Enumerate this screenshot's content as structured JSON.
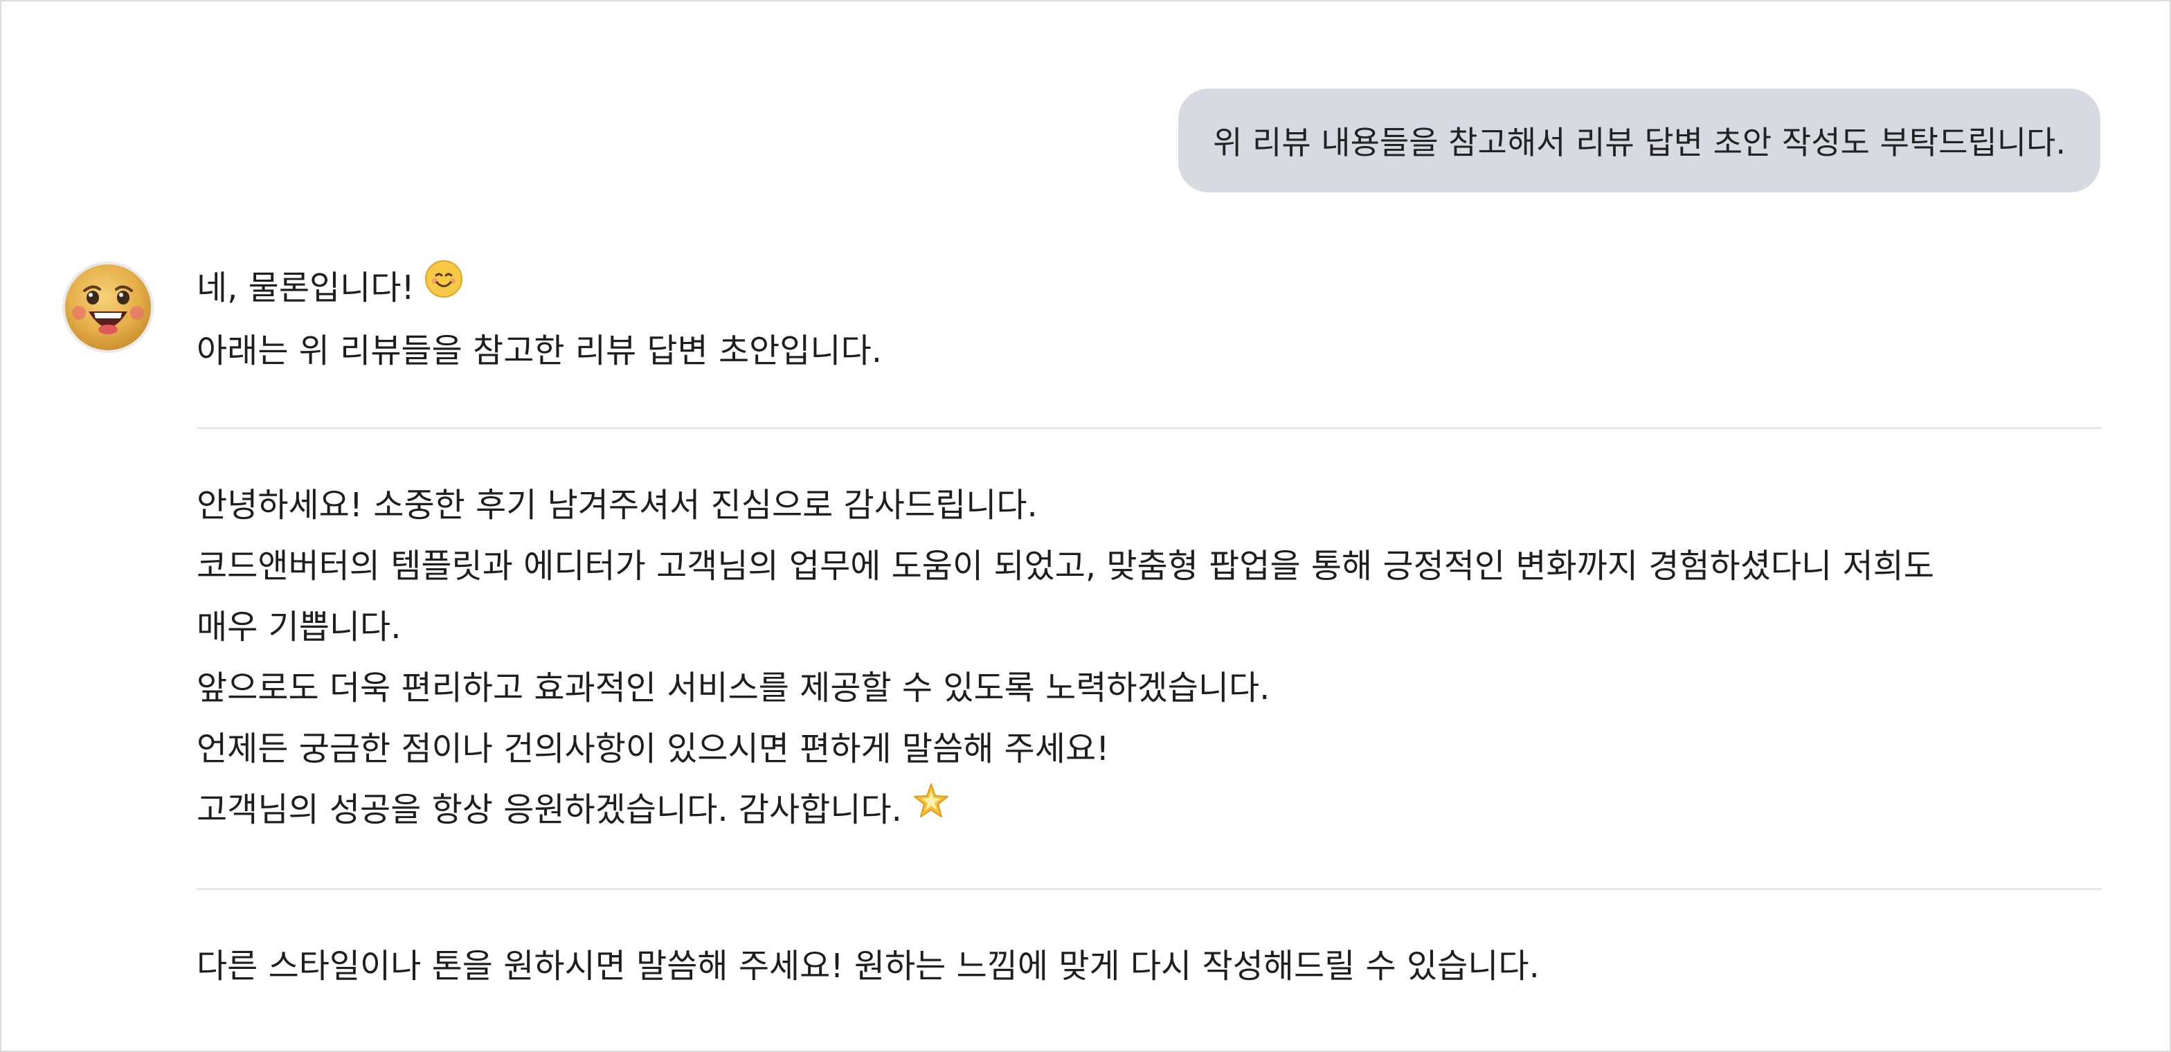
{
  "user_message": {
    "text": "위 리뷰 내용들을 참고해서 리뷰 답변 초안 작성도 부탁드립니다."
  },
  "assistant": {
    "avatar_icon": "smiling-face-avatar-icon",
    "intro_line1": "네, 물론입니다!",
    "intro_line1_emoji": "smiling-face-emoji-icon",
    "intro_line2": "아래는 위 리뷰들을 참고한 리뷰 답변 초안입니다.",
    "draft_lines": [
      "안녕하세요! 소중한 후기 남겨주셔서 진심으로 감사드립니다.",
      "코드앤버터의 템플릿과 에디터가 고객님의 업무에 도움이 되었고, 맞춤형 팝업을 통해 긍정적인 변화까지 경험하셨다니 저희도",
      "매우 기쁩니다.",
      "앞으로도 더욱 편리하고 효과적인 서비스를 제공할 수 있도록 노력하겠습니다.",
      "언제든 궁금한 점이나 건의사항이 있으시면 편하게 말씀해 주세요!",
      "고객님의 성공을 항상 응원하겠습니다. 감사합니다."
    ],
    "draft_last_emoji": "glowing-star-emoji-icon",
    "closing_line": "다른 스타일이나 톤을 원하시면 말씀해 주세요! 원하는 느낌에 맞게 다시 작성해드릴 수 있습니다."
  },
  "colors": {
    "user_bubble_bg": "#d7dae0",
    "divider": "#e4e6ea",
    "text": "#1e1e1e"
  }
}
